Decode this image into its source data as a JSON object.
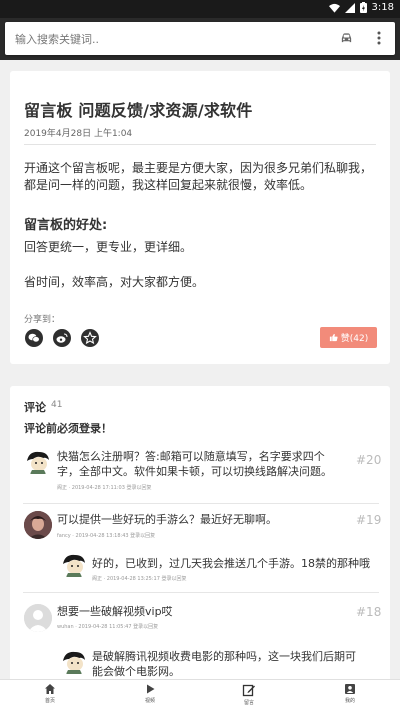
{
  "status_bar": {
    "time": "3:18"
  },
  "search": {
    "placeholder": "输入搜索关键词.."
  },
  "article": {
    "title": "留言板 问题反馈/求资源/求软件",
    "date": "2019年4月28日 上午1:04",
    "paragraph1": "开通这个留言板呢，最主要是方便大家，因为很多兄弟们私聊我，都是问一样的问题，我这样回复起来就很慢，效率低。",
    "subheading": "留言板的好处:",
    "paragraph2": "回答更统一，更专业，更详细。",
    "paragraph3": "省时间，效率高，对大家都方便。",
    "share_label": "分享到：",
    "share_icons": [
      "wechat-icon",
      "weibo-icon",
      "qzone-star-icon"
    ],
    "like_label": "赞(42)"
  },
  "comments_section": {
    "heading": "评论",
    "count": "41",
    "login_notice": "评论前必须登录！",
    "comments": [
      {
        "text": "快猫怎么注册啊？答:邮箱可以随意填写，名字要求四个字，全部中文。软件如果卡顿，可以切换线路解决问题。",
        "meta": "阁正 · 2019-04-28 17:11:03 登录以回复",
        "floor": "#20"
      },
      {
        "text": "可以提供一些好玩的手游么？最近好无聊啊。",
        "meta": "fancy · 2019-04-28 13:18:43 登录以回复",
        "floor": "#19"
      },
      {
        "text": "好的，已收到，过几天我会推送几个手游。18禁的那种哦",
        "meta": "阁正 · 2019-04-28 13:25:17 登录以回复",
        "floor": ""
      },
      {
        "text": "想要一些破解视频vip哎",
        "meta": "wuhan · 2019-04-28 11:05:47 登录以回复",
        "floor": "#18"
      },
      {
        "text": "是破解腾讯视频收费电影的那种吗，这一块我们后期可能会做个电影网。",
        "meta": "",
        "floor": ""
      }
    ]
  },
  "bottom_nav": [
    {
      "label": "首页",
      "icon": "home-icon"
    },
    {
      "label": "视频",
      "icon": "video-play-icon"
    },
    {
      "label": "留言",
      "icon": "edit-icon"
    },
    {
      "label": "我的",
      "icon": "profile-icon"
    }
  ]
}
